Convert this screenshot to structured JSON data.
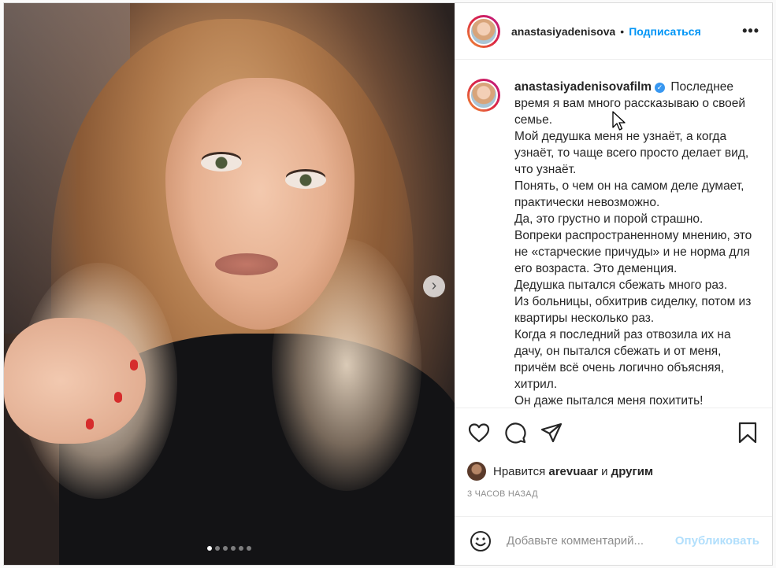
{
  "post": {
    "username": "anastasiyadenisova",
    "full_username": "anastasiyadenisovafilm",
    "separator": "•",
    "follow_label": "Подписаться",
    "more_label": "•••",
    "verified_icon": "verified-badge-icon",
    "caption_lines": [
      "Последнее время я вам много рассказываю о своей семье.",
      "Мой дедушка меня не узнаёт, а когда узнаёт, то чаще всего просто делает вид, что узнаёт.",
      "Понять, о чем он на самом деле думает, практически невозможно.",
      "Да, это грустно и порой страшно.",
      "Вопреки распространенному мнению, это не «старческие причуды» и не норма для его возраста. Это деменция.",
      "Дедушка пытался сбежать много раз.",
      "Из больницы, обхитрив сиделку, потом из квартиры несколько раз.",
      "Когда я последний раз отвозила их на дачу, он пытался сбежать и от меня, причём всё очень логично объясняя, хитрил.",
      "Он даже пытался меня похитить!"
    ],
    "likes": {
      "prefix": "Нравится",
      "user": "arevuaar",
      "and": "и",
      "others": "другим"
    },
    "time_ago": "3 ЧАСОВ НАЗАД",
    "comment": {
      "placeholder": "Добавьте комментарий...",
      "publish_label": "Опубликовать"
    },
    "carousel": {
      "total": 6,
      "active_index": 0,
      "next_arrow": "›"
    }
  },
  "colors": {
    "accent": "#0095f6",
    "publish_disabled": "#b2dffc",
    "verified": "#3897f0"
  }
}
